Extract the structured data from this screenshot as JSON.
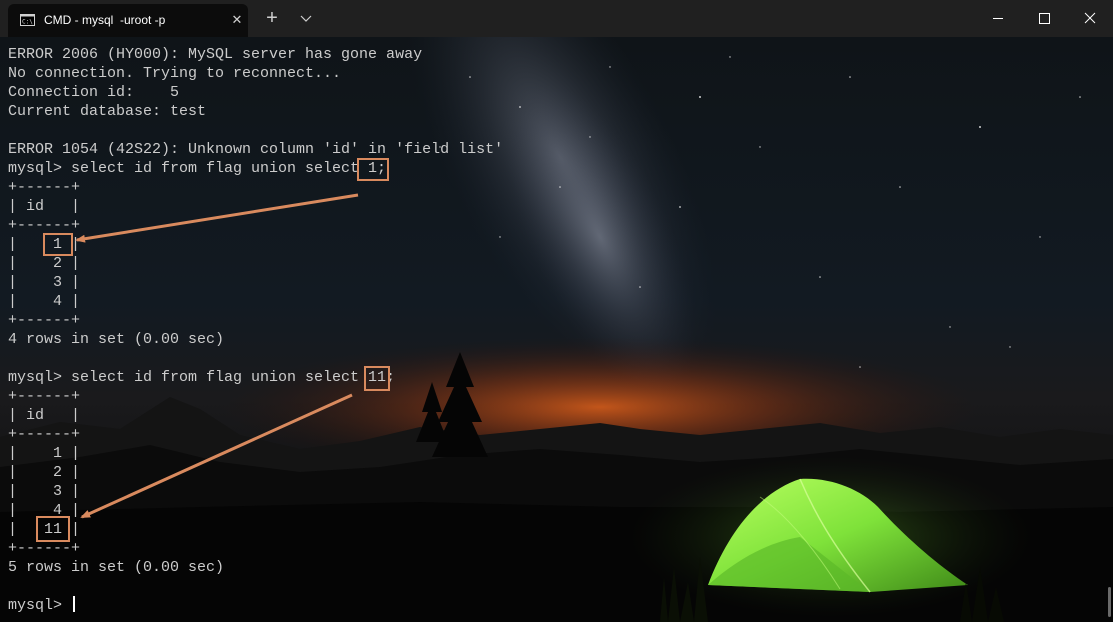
{
  "tab": {
    "title": "CMD - mysql  -uroot -p",
    "icon": "command-prompt-icon",
    "close_glyph": "✕"
  },
  "titlebar": {
    "new_tab_glyph": "+"
  },
  "terminal": {
    "lines": [
      "ERROR 2006 (HY000): MySQL server has gone away",
      "No connection. Trying to reconnect...",
      "Connection id:    5",
      "Current database: test",
      "",
      "ERROR 1054 (42S22): Unknown column 'id' in 'field list'",
      "mysql> select id from flag union select 1;",
      "+------+",
      "| id   |",
      "+------+",
      "|    1 |",
      "|    2 |",
      "|    3 |",
      "|    4 |",
      "+------+",
      "4 rows in set (0.00 sec)",
      "",
      "mysql> select id from flag union select 11;",
      "+------+",
      "| id   |",
      "+------+",
      "|    1 |",
      "|    2 |",
      "|    3 |",
      "|    4 |",
      "|   11 |",
      "+------+",
      "5 rows in set (0.00 sec)",
      "",
      "mysql> "
    ]
  },
  "colors": {
    "text": "#cccccc",
    "annotation": "#d98a5e",
    "tent": "#7fe23a",
    "glow": "#e0601a"
  }
}
